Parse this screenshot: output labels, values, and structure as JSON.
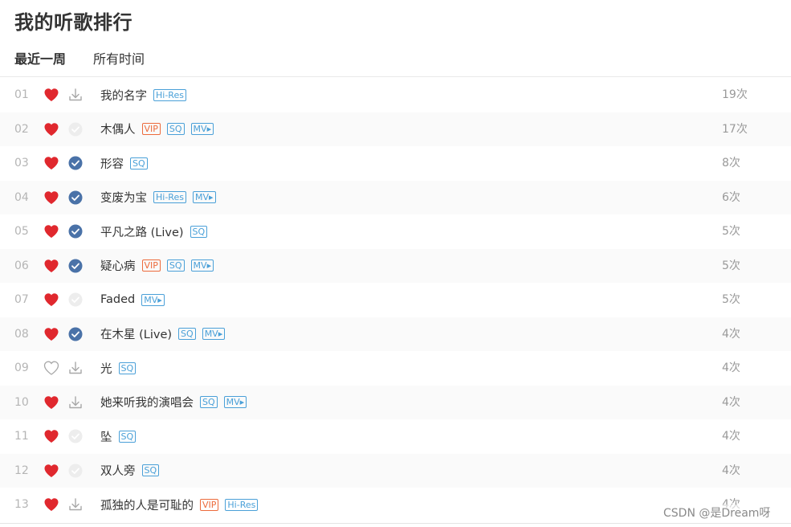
{
  "page": {
    "title": "我的听歌排行",
    "tabs": [
      {
        "label": "最近一周",
        "active": true
      },
      {
        "label": "所有时间",
        "active": false
      }
    ]
  },
  "colors": {
    "heart_red": "#e0282e",
    "check_blue": "#4a72a8",
    "tag_blue": "#4aa0d8",
    "tag_vip": "#ec6b3c"
  },
  "songs": [
    {
      "index": "01",
      "liked": true,
      "status": "download-icon",
      "name": "我的名字",
      "tags": [
        "Hi-Res"
      ],
      "count": "19次"
    },
    {
      "index": "02",
      "liked": true,
      "status": "check-grey-icon",
      "name": "木偶人",
      "tags": [
        "VIP",
        "SQ",
        "MV▸"
      ],
      "count": "17次"
    },
    {
      "index": "03",
      "liked": true,
      "status": "check-blue-icon",
      "name": "形容",
      "tags": [
        "SQ"
      ],
      "count": "8次"
    },
    {
      "index": "04",
      "liked": true,
      "status": "check-blue-icon",
      "name": "变废为宝",
      "tags": [
        "Hi-Res",
        "MV▸"
      ],
      "count": "6次"
    },
    {
      "index": "05",
      "liked": true,
      "status": "check-blue-icon",
      "name": "平凡之路 (Live)",
      "tags": [
        "SQ"
      ],
      "count": "5次"
    },
    {
      "index": "06",
      "liked": true,
      "status": "check-blue-icon",
      "name": "疑心病",
      "tags": [
        "VIP",
        "SQ",
        "MV▸"
      ],
      "count": "5次"
    },
    {
      "index": "07",
      "liked": true,
      "status": "check-grey-icon",
      "name": "Faded",
      "tags": [
        "MV▸"
      ],
      "count": "5次"
    },
    {
      "index": "08",
      "liked": true,
      "status": "check-blue-icon",
      "name": "在木星 (Live)",
      "tags": [
        "SQ",
        "MV▸"
      ],
      "count": "4次"
    },
    {
      "index": "09",
      "liked": false,
      "status": "download-icon",
      "name": "光",
      "tags": [
        "SQ"
      ],
      "count": "4次"
    },
    {
      "index": "10",
      "liked": true,
      "status": "download-icon",
      "name": "她来听我的演唱会",
      "tags": [
        "SQ",
        "MV▸"
      ],
      "count": "4次"
    },
    {
      "index": "11",
      "liked": true,
      "status": "check-grey-icon",
      "name": "坠",
      "tags": [
        "SQ"
      ],
      "count": "4次"
    },
    {
      "index": "12",
      "liked": true,
      "status": "check-grey-icon",
      "name": "双人旁",
      "tags": [
        "SQ"
      ],
      "count": "4次"
    },
    {
      "index": "13",
      "liked": true,
      "status": "download-icon",
      "name": "孤独的人是可耻的",
      "tags": [
        "VIP",
        "Hi-Res"
      ],
      "count": "4次"
    }
  ],
  "watermark": "CSDN @是Dream呀"
}
